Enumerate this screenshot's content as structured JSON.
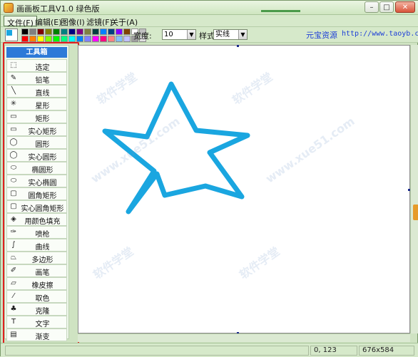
{
  "window": {
    "title": "画画板工具V1.0 绿色版",
    "min_glyph": "–",
    "max_glyph": "□",
    "close_glyph": "✕"
  },
  "menu": {
    "items": [
      {
        "label": "文件(F)",
        "active": true
      },
      {
        "label": "编辑(E)"
      },
      {
        "label": "图像(I)"
      },
      {
        "label": "滤镜(F)"
      },
      {
        "label": "关于(A)"
      }
    ]
  },
  "toolbar": {
    "current_color": "#1aa6e0",
    "palette_row1": [
      "#000000",
      "#808080",
      "#800000",
      "#808000",
      "#008000",
      "#008080",
      "#000080",
      "#800080",
      "#808040",
      "#004040",
      "#0080ff",
      "#004080",
      "#8000ff",
      "#804000",
      "#ffffff",
      "#c0c0c0"
    ],
    "palette_row2": [
      "#ff0000",
      "#ff8000",
      "#ffff00",
      "#80ff00",
      "#00ff00",
      "#00ff80",
      "#00ffff",
      "#0080ff",
      "#8080ff",
      "#ff00ff",
      "#ff0080",
      "#ff8080",
      "#80c0ff",
      "#c0c0ff",
      "#a0a0a0",
      "#e0e0e0"
    ],
    "width_label": "宽度:",
    "width_value": "10",
    "style_label": "样式",
    "style_value": "实线",
    "brand_label": "元宝资源",
    "brand_url": "http://www.taoyb.com"
  },
  "toolbox": {
    "header": "工具箱",
    "tools": [
      {
        "label": "选定",
        "icon": "select-icon",
        "glyph": "⬚"
      },
      {
        "label": "铅笔",
        "icon": "pencil-icon",
        "glyph": "✎"
      },
      {
        "label": "直线",
        "icon": "line-icon",
        "glyph": "╲"
      },
      {
        "label": "星形",
        "icon": "star-icon",
        "glyph": "✳"
      },
      {
        "label": "矩形",
        "icon": "rectangle-icon",
        "glyph": "▭"
      },
      {
        "label": "实心矩形",
        "icon": "filled-rectangle-icon",
        "glyph": "▭"
      },
      {
        "label": "圆形",
        "icon": "circle-icon",
        "glyph": "◯"
      },
      {
        "label": "实心圆形",
        "icon": "filled-circle-icon",
        "glyph": "◯"
      },
      {
        "label": "椭圆形",
        "icon": "ellipse-icon",
        "glyph": "⬭"
      },
      {
        "label": "实心椭圆",
        "icon": "filled-ellipse-icon",
        "glyph": "⬭"
      },
      {
        "label": "圆角矩形",
        "icon": "rounded-rectangle-icon",
        "glyph": "▢"
      },
      {
        "label": "实心圆角矩形",
        "icon": "filled-rounded-rectangle-icon",
        "glyph": "▢"
      },
      {
        "label": "用颜色填充",
        "icon": "fill-bucket-icon",
        "glyph": "◈"
      },
      {
        "label": "喷枪",
        "icon": "airbrush-icon",
        "glyph": "✑"
      },
      {
        "label": "曲线",
        "icon": "curve-icon",
        "glyph": "∫"
      },
      {
        "label": "多边形",
        "icon": "polygon-icon",
        "glyph": "⏢"
      },
      {
        "label": "画笔",
        "icon": "brush-icon",
        "glyph": "✐"
      },
      {
        "label": "橡皮擦",
        "icon": "eraser-icon",
        "glyph": "▱"
      },
      {
        "label": "取色",
        "icon": "eyedropper-icon",
        "glyph": "⁄"
      },
      {
        "label": "克隆",
        "icon": "clone-icon",
        "glyph": "♣"
      },
      {
        "label": "文字",
        "icon": "text-icon",
        "glyph": "T"
      },
      {
        "label": "渐变",
        "icon": "gradient-icon",
        "glyph": "▤"
      }
    ]
  },
  "canvas": {
    "stroke_color": "#1aa6e0"
  },
  "status": {
    "coords": "0, 123",
    "size": "676x584"
  },
  "watermark": {
    "text": "软件学堂",
    "url_text": "www.xue51.com"
  }
}
